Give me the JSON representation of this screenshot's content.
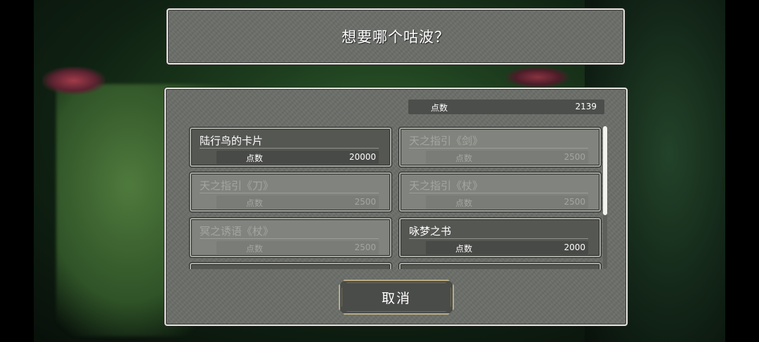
{
  "prompt": {
    "title": "想要哪个咕波？"
  },
  "points": {
    "label": "点数",
    "value": "2139"
  },
  "items": [
    {
      "name": "陆行鸟的卡片",
      "cost_label": "点数",
      "cost": "20000",
      "available": true
    },
    {
      "name": "天之指引《剑》",
      "cost_label": "点数",
      "cost": "2500",
      "available": false
    },
    {
      "name": "天之指引《刀》",
      "cost_label": "点数",
      "cost": "2500",
      "available": false
    },
    {
      "name": "天之指引《杖》",
      "cost_label": "点数",
      "cost": "2500",
      "available": false
    },
    {
      "name": "冥之诱语《杖》",
      "cost_label": "点数",
      "cost": "2500",
      "available": false
    },
    {
      "name": "咏梦之书",
      "cost_label": "点数",
      "cost": "2000",
      "available": true
    }
  ],
  "buttons": {
    "cancel": "取消"
  }
}
